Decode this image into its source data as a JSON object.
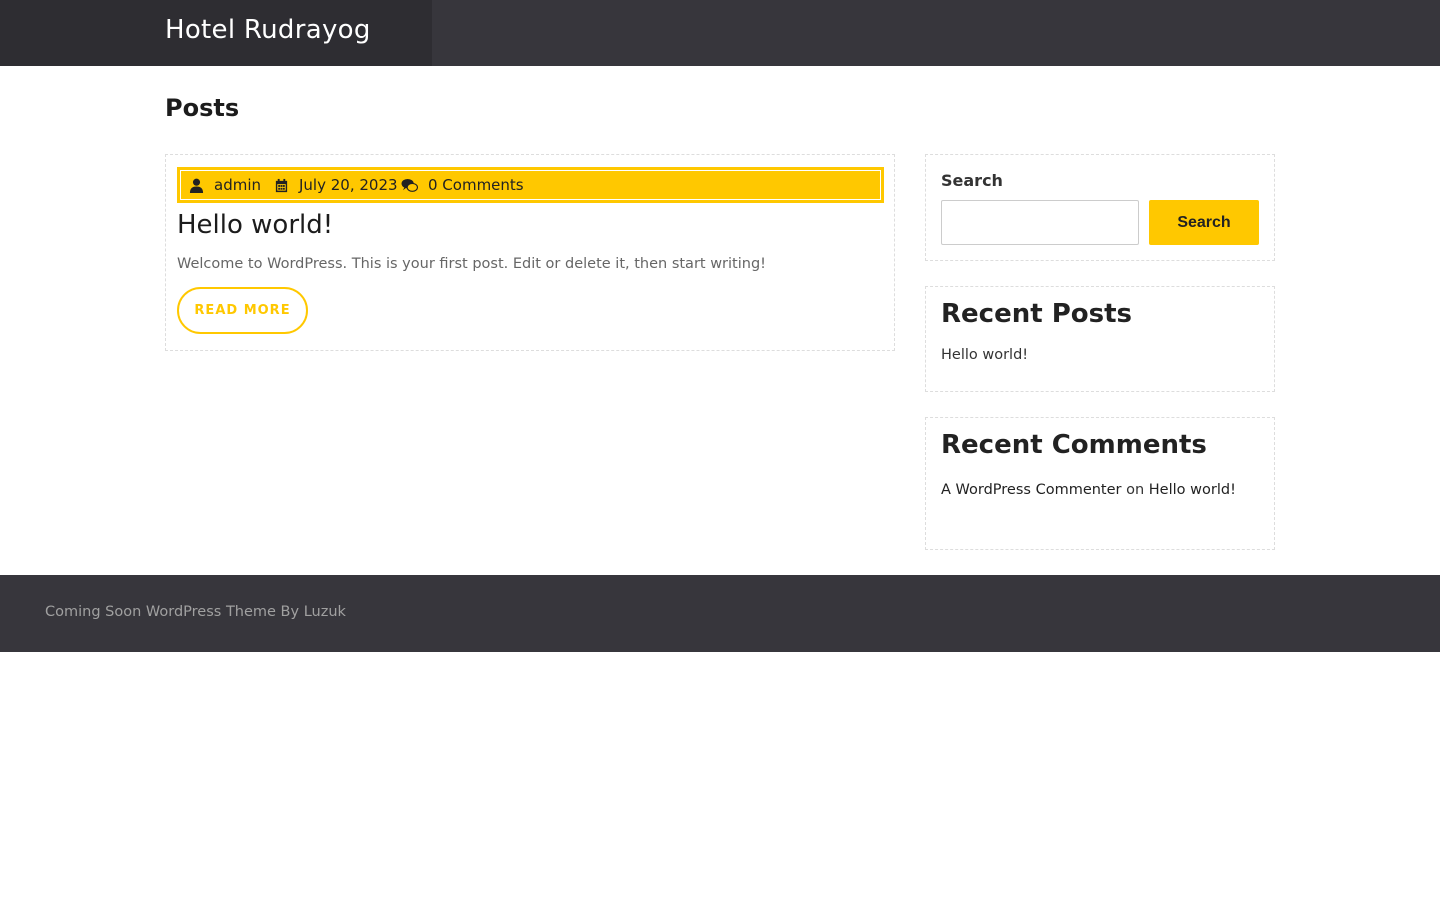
{
  "header": {
    "site_title": "Hotel Rudrayog"
  },
  "page": {
    "title": "Posts"
  },
  "post": {
    "author": "admin",
    "date": "July 20, 2023",
    "comments": "0 Comments",
    "title": "Hello world!",
    "excerpt": "Welcome to WordPress. This is your first post. Edit or delete it, then start writing!",
    "read_more_label": "READ MORE"
  },
  "sidebar": {
    "search": {
      "label": "Search",
      "input_value": "",
      "button_label": "Search"
    },
    "recent_posts": {
      "title": "Recent Posts",
      "items": [
        "Hello world!"
      ]
    },
    "recent_comments": {
      "title": "Recent Comments",
      "items": [
        {
          "author": "A WordPress Commenter",
          "connector": "on",
          "post": "Hello world!"
        }
      ]
    }
  },
  "footer": {
    "credit_prefix": "Coming Soon WordPress Theme By",
    "credit_link": "Luzuk"
  },
  "colors": {
    "header_bg": "#37363c",
    "brand_bg": "#2e2d32",
    "accent": "#ffc800",
    "footer_bg": "#37363c"
  },
  "icons": {
    "author": "user-icon",
    "date": "calendar-icon",
    "comments": "comments-icon"
  }
}
